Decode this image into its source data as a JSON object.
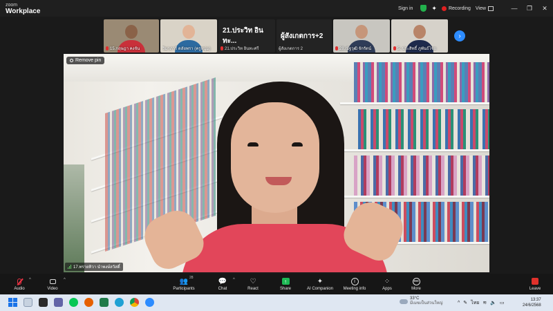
{
  "app": {
    "brand_line1": "zoom",
    "brand_line2": "Workplace"
  },
  "titlebar": {
    "sign_in": "Sign in",
    "recording": "Recording",
    "view": "View",
    "minimize_glyph": "—",
    "maximize_glyph": "❐",
    "close_glyph": "✕"
  },
  "thumbnails": [
    {
      "name": "15.กฤษฎา คงจัน",
      "shirt": "#c9303a",
      "bg": "#9a8a74",
      "muted": true
    },
    {
      "name": "วิมาภาร์ ดลัยพรา (ครูหนุ่ม)",
      "shirt": "#2c6aa0",
      "bg": "#d9d3c7",
      "muted": false
    },
    {
      "bigname": "21.ประวิท อินทะ...",
      "name": "21.ประวิท อินทะศรี",
      "muted": true
    },
    {
      "bigname": "ผู้สังเกตการ+2",
      "name": "ผู้สังเกตการ 2",
      "muted": false
    },
    {
      "name": "28.ณัฐวุฒิ จักรัตน์",
      "shirt": "#2f3c58",
      "bg": "#c8c6c0",
      "muted": true
    },
    {
      "name": "5. ประสิทธิ์ ภูพันธ์ไชย",
      "shirt": "#1e2a4c",
      "bg": "#d6d2ca",
      "muted": true
    }
  ],
  "strip": {
    "next_glyph": "›"
  },
  "main": {
    "remove_pin": "Remove pin",
    "participant_name": "17.ทรายทิวา นำพงษ์สวัสดิ์"
  },
  "toolbar": {
    "audio": "Audio",
    "video": "Video",
    "participants": "Participants",
    "participants_count": "28",
    "chat": "Chat",
    "react": "React",
    "share": "Share",
    "ai_companion": "AI Companion",
    "meeting_info": "Meeting info",
    "apps": "Apps",
    "more": "More",
    "leave": "Leave",
    "caret": "^"
  },
  "taskbar": {
    "weather_temp": "33°C",
    "weather_desc": "มีเมฆเป็นส่วนใหญ่",
    "tray_chevron": "^",
    "language": "ไทย",
    "time": "13:37",
    "date": "24/6/2568"
  },
  "colors": {
    "accent": "#2d8cff",
    "recording": "#e02020",
    "share": "#1db954",
    "leave": "#e0312b"
  }
}
